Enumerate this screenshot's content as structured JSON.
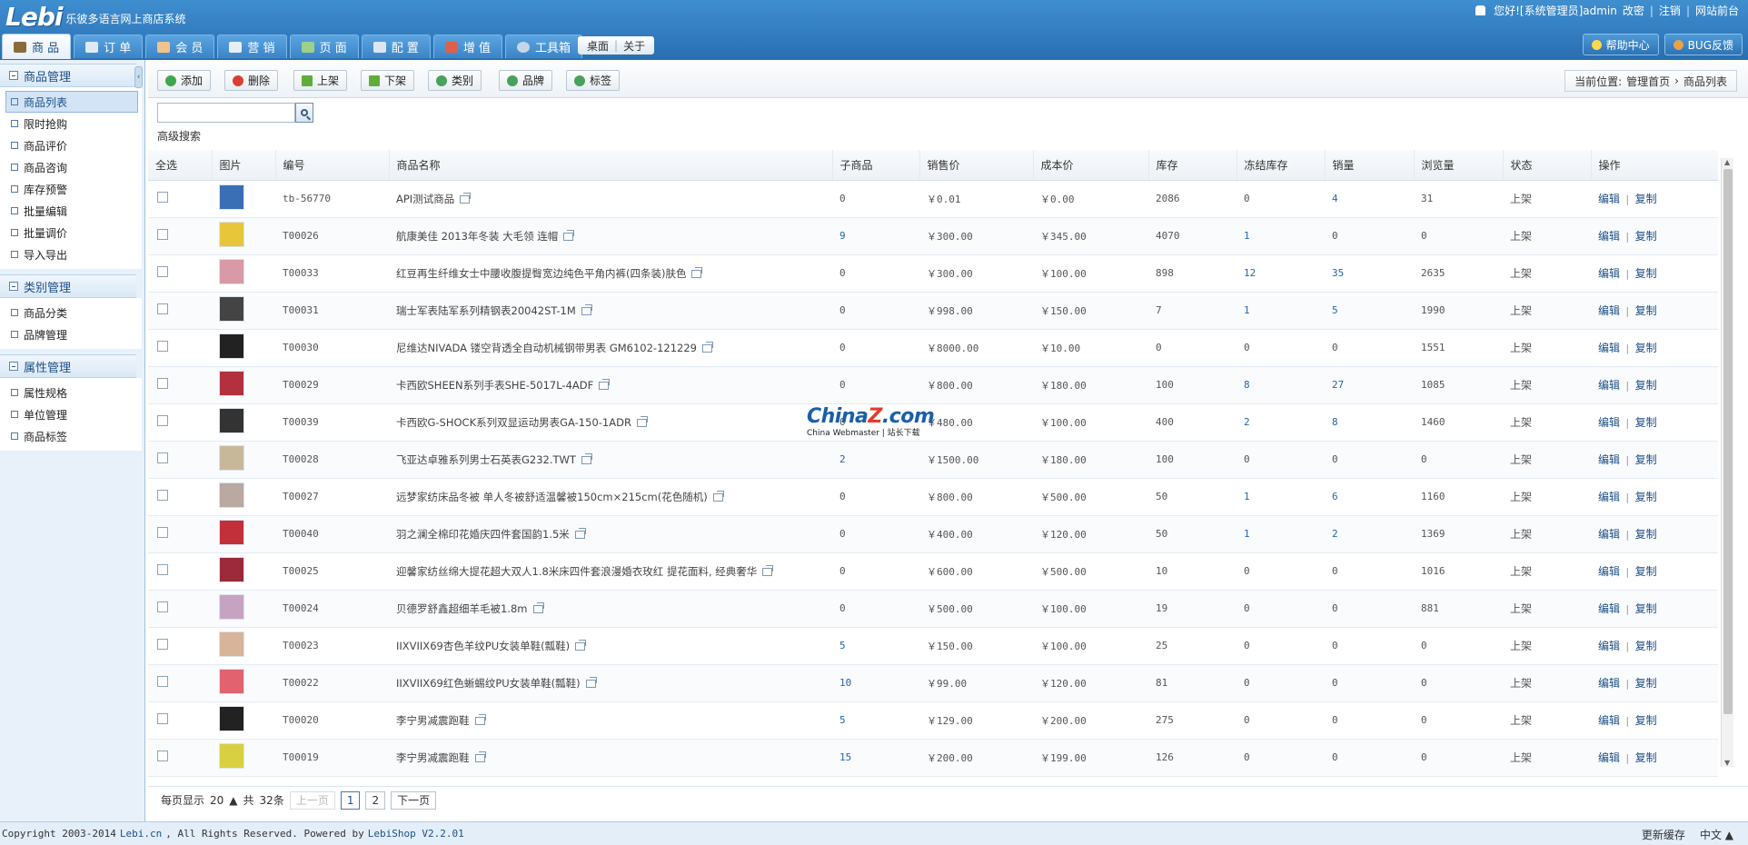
{
  "header": {
    "logo_text": "Lebi",
    "app_title": "乐彼多语言网上商店系统",
    "greeting": "您好![系统管理员]admin",
    "links": [
      "改密",
      "注销",
      "网站前台"
    ],
    "tabs": [
      "商 品",
      "订 单",
      "会 员",
      "营 销",
      "页 面",
      "配 置",
      "增 值",
      "工具箱"
    ],
    "quick": [
      "桌面",
      "关于"
    ],
    "help": "帮助中心",
    "bug": "BUG反馈"
  },
  "sidebar": {
    "groups": [
      {
        "title": "商品管理",
        "items": [
          "商品列表",
          "限时抢购",
          "商品评价",
          "商品咨询",
          "库存预警",
          "批量编辑",
          "批量调价",
          "导入导出"
        ]
      },
      {
        "title": "类别管理",
        "items": [
          "商品分类",
          "品牌管理"
        ]
      },
      {
        "title": "属性管理",
        "items": [
          "属性规格",
          "单位管理",
          "商品标签"
        ]
      }
    ]
  },
  "toolbar": {
    "buttons": [
      "添加",
      "删除",
      "上架",
      "下架",
      "类别",
      "品牌",
      "标签"
    ],
    "breadcrumb_prefix": "当前位置:",
    "breadcrumb_home": "管理首页",
    "breadcrumb_sep": "›",
    "breadcrumb_current": "商品列表"
  },
  "search": {
    "advanced": "高级搜索",
    "placeholder": ""
  },
  "table": {
    "headers": [
      "全选",
      "图片",
      "编号",
      "商品名称",
      "子商品",
      "销售价",
      "成本价",
      "库存",
      "冻结库存",
      "销量",
      "浏览量",
      "状态",
      "操作"
    ],
    "edit_label": "编辑",
    "copy_label": "复制",
    "rows": [
      {
        "code": "tb-56770",
        "name": "API测试商品",
        "sub": "0",
        "price": "￥0.01",
        "cost": "￥0.00",
        "stock": "2086",
        "frozen": "0",
        "sales": "4",
        "views": "31",
        "status": "上架"
      },
      {
        "code": "T00026",
        "name": "航康美佳 2013年冬装 大毛领 连帽",
        "sub": "9",
        "price": "￥300.00",
        "cost": "￥345.00",
        "stock": "4070",
        "frozen": "1",
        "sales": "0",
        "views": "0",
        "status": "上架"
      },
      {
        "code": "T00033",
        "name": "红豆再生纤维女士中腰收腹提臀宽边纯色平角内裤(四条装)肤色",
        "sub": "0",
        "price": "￥300.00",
        "cost": "￥100.00",
        "stock": "898",
        "frozen": "12",
        "sales": "35",
        "views": "2635",
        "status": "上架"
      },
      {
        "code": "T00031",
        "name": "瑞士军表陆军系列精钢表20042ST-1M",
        "sub": "0",
        "price": "￥998.00",
        "cost": "￥150.00",
        "stock": "7",
        "frozen": "1",
        "sales": "5",
        "views": "1990",
        "status": "上架"
      },
      {
        "code": "T00030",
        "name": "尼维达NIVADA 镂空背透全自动机械钢带男表 GM6102-121229",
        "sub": "0",
        "price": "￥8000.00",
        "cost": "￥10.00",
        "stock": "0",
        "frozen": "0",
        "sales": "0",
        "views": "1551",
        "status": "上架"
      },
      {
        "code": "T00029",
        "name": "卡西欧SHEEN系列手表SHE-5017L-4ADF",
        "sub": "0",
        "price": "￥800.00",
        "cost": "￥180.00",
        "stock": "100",
        "frozen": "8",
        "sales": "27",
        "views": "1085",
        "status": "上架"
      },
      {
        "code": "T00039",
        "name": "卡西欧G-SHOCK系列双显运动男表GA-150-1ADR",
        "sub": "0",
        "price": "￥480.00",
        "cost": "￥100.00",
        "stock": "400",
        "frozen": "2",
        "sales": "8",
        "views": "1460",
        "status": "上架"
      },
      {
        "code": "T00028",
        "name": "飞亚达卓雅系列男士石英表G232.TWT",
        "sub": "2",
        "price": "￥1500.00",
        "cost": "￥180.00",
        "stock": "100",
        "frozen": "0",
        "sales": "0",
        "views": "0",
        "status": "上架"
      },
      {
        "code": "T00027",
        "name": "远梦家纺床品冬被 单人冬被舒适温馨被150cm×215cm(花色随机)",
        "sub": "0",
        "price": "￥800.00",
        "cost": "￥500.00",
        "stock": "50",
        "frozen": "1",
        "sales": "6",
        "views": "1160",
        "status": "上架"
      },
      {
        "code": "T00040",
        "name": "羽之澜全棉印花婚庆四件套国韵1.5米",
        "sub": "0",
        "price": "￥400.00",
        "cost": "￥120.00",
        "stock": "50",
        "frozen": "1",
        "sales": "2",
        "views": "1369",
        "status": "上架"
      },
      {
        "code": "T00025",
        "name": "迎馨家纺丝绵大提花超大双人1.8米床四件套浪漫婚衣玫红 提花面料, 经典奢华",
        "sub": "0",
        "price": "￥600.00",
        "cost": "￥500.00",
        "stock": "10",
        "frozen": "0",
        "sales": "0",
        "views": "1016",
        "status": "上架"
      },
      {
        "code": "T00024",
        "name": "贝德罗舒鑫超细羊毛被1.8m",
        "sub": "0",
        "price": "￥500.00",
        "cost": "￥100.00",
        "stock": "19",
        "frozen": "0",
        "sales": "0",
        "views": "881",
        "status": "上架"
      },
      {
        "code": "T00023",
        "name": "IIXVIIX69杏色羊纹PU女装单鞋(瓢鞋)",
        "sub": "5",
        "price": "￥150.00",
        "cost": "￥100.00",
        "stock": "25",
        "frozen": "0",
        "sales": "0",
        "views": "0",
        "status": "上架"
      },
      {
        "code": "T00022",
        "name": "IIXVIIX69红色蜥蜴纹PU女装单鞋(瓢鞋)",
        "sub": "10",
        "price": "￥99.00",
        "cost": "￥120.00",
        "stock": "81",
        "frozen": "0",
        "sales": "0",
        "views": "0",
        "status": "上架"
      },
      {
        "code": "T00020",
        "name": "李宁男减震跑鞋",
        "sub": "5",
        "price": "￥129.00",
        "cost": "￥200.00",
        "stock": "275",
        "frozen": "0",
        "sales": "0",
        "views": "0",
        "status": "上架"
      },
      {
        "code": "T00019",
        "name": "李宁男减震跑鞋",
        "sub": "15",
        "price": "￥200.00",
        "cost": "￥199.00",
        "stock": "126",
        "frozen": "0",
        "sales": "0",
        "views": "0",
        "status": "上架"
      }
    ]
  },
  "pager": {
    "per_page_label": "每页显示",
    "per_page": "20",
    "total_prefix": "共",
    "total": "32条",
    "prev": "上一页",
    "pages": [
      "1",
      "2"
    ],
    "next": "下一页"
  },
  "footer": {
    "copyright": "Copyright 2003-2014",
    "site": "Lebi.cn",
    "rights": ", All Rights Reserved. Powered by",
    "product": "LebiShop V2.2.01",
    "refresh": "更新缓存",
    "lang": "中文"
  },
  "watermark": {
    "main_a": "China",
    "main_z": "Z",
    "main_b": ".com",
    "sub": "China Webmaster | 站长下载"
  },
  "colors": {
    "header_blue": "#2f78bb",
    "link_blue": "#1c4f85",
    "sidebar_bg": "#e8f1fa"
  }
}
